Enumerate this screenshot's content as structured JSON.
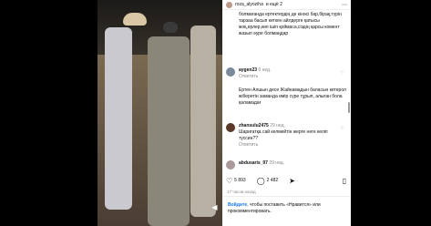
{
  "header": {
    "username": "roza_alyoziha",
    "collab": "и ещё 2"
  },
  "comments": [
    {
      "text": "болмағанда ертектердің де кінәсі бар,бірақ,түрін тарзаа басып кеткен айлдерге қатысы жоқ,ерлер,көп ішіп қоймаса,сіздің қарсы комент жазып әуре болмаңдар",
      "user": "",
      "meta": ""
    },
    {
      "user": "aygen23",
      "time": "6 нед.",
      "reply": "Ответить",
      "text": "Ертен Алшын десе Жайнамадын баласын кетерол жіберетін заманда өмір сүре тұрып, алыған бола қаламадағ"
    },
    {
      "user": "zhansulu2475",
      "time": "29 нед.",
      "reply": "Ответить",
      "text": "Шаригатқа сай келмейтін жерге неге келіп түссин??"
    },
    {
      "user": "abdusaris_97",
      "time": "29 нед.",
      "reply": "",
      "text": ""
    }
  ],
  "actions": {
    "likes": "5 893",
    "comments": "2 482"
  },
  "timestamp": "17 часов назад",
  "login": {
    "link": "Войдите",
    "text": ", чтобы поставить «Нравится» или прокомментировать."
  },
  "colors": {
    "link": "#1877f2"
  },
  "icons": [
    "more-icon",
    "heart-icon",
    "comment-icon",
    "share-icon",
    "bookmark-icon",
    "mute-icon"
  ]
}
